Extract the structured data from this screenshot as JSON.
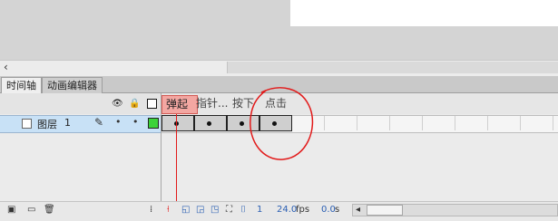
{
  "tabs": [
    {
      "label": "时间轴"
    },
    {
      "label": "动画编辑器"
    }
  ],
  "labels": [
    {
      "text": "弹起"
    },
    {
      "text": "指针..."
    },
    {
      "text": "按下"
    },
    {
      "text": "点击"
    }
  ],
  "layer": {
    "name": "图层",
    "number": "1",
    "color": "#3bd33b"
  },
  "toolbar": {
    "frame": "1",
    "fps": "24.0",
    "fps_unit": "fps",
    "time": "0.0",
    "time_unit": "s"
  },
  "annotation_color": "#e21a1a"
}
